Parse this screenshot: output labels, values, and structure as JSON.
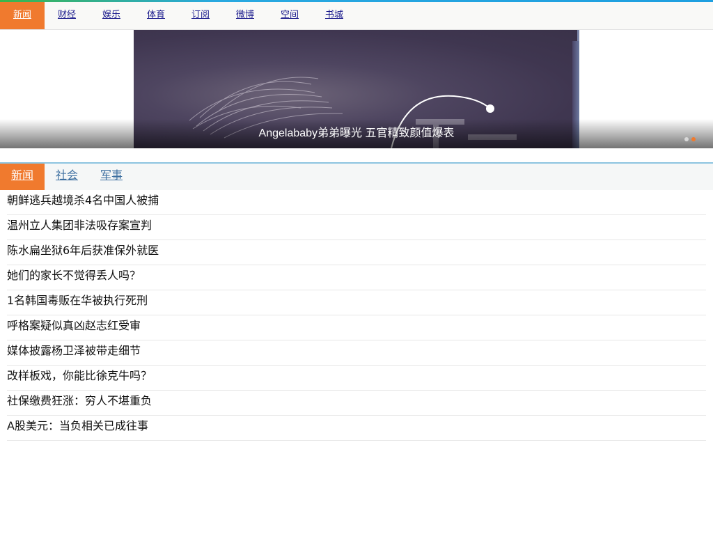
{
  "top_nav": {
    "items": [
      {
        "label": "新闻",
        "active": true
      },
      {
        "label": "财经",
        "active": false
      },
      {
        "label": "娱乐",
        "active": false
      },
      {
        "label": "体育",
        "active": false
      },
      {
        "label": "订阅",
        "active": false
      },
      {
        "label": "微博",
        "active": false
      },
      {
        "label": "空间",
        "active": false
      },
      {
        "label": "书城",
        "active": false
      }
    ]
  },
  "banner": {
    "caption": "Angelababy弟弟曝光 五官精致颜值爆表",
    "slide_count": 2,
    "active_slide": 2
  },
  "sub_tabs": {
    "items": [
      {
        "label": "新闻",
        "active": true
      },
      {
        "label": "社会",
        "active": false
      },
      {
        "label": "军事",
        "active": false
      }
    ]
  },
  "news": {
    "items": [
      "朝鲜逃兵越境杀4名中国人被捕",
      "温州立人集团非法吸存案宣判",
      "陈水扁坐狱6年后获准保外就医",
      "她们的家长不觉得丢人吗？",
      "1名韩国毒贩在华被执行死刑",
      "呼格案疑似真凶赵志红受审",
      "媒体披露杨卫泽被带走细节",
      "改样板戏，你能比徐克牛吗？",
      "社保缴费狂涨：穷人不堪重负",
      "A股美元：当负相关已成往事"
    ]
  },
  "colors": {
    "accent": "#f07a2e",
    "link": "#1a1a8c",
    "tab_link": "#3d6fa0"
  }
}
